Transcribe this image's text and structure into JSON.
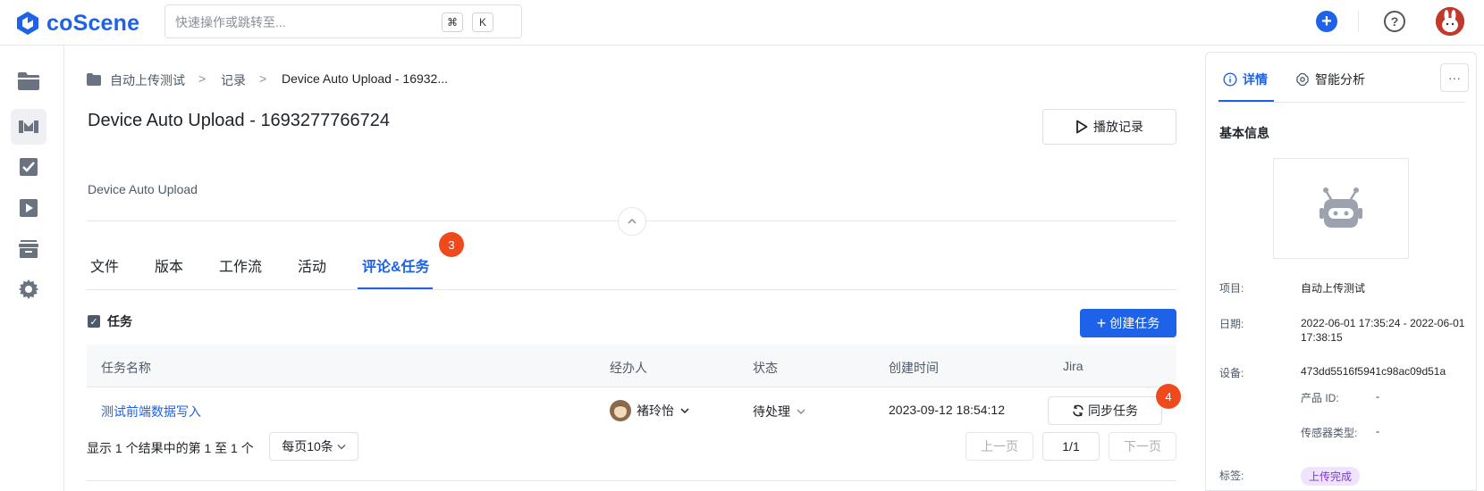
{
  "app": {
    "name": "coScene"
  },
  "search": {
    "placeholder": "快速操作或跳转至...",
    "kbd_cmd": "⌘",
    "kbd_key": "K"
  },
  "topbar": {
    "add_label": "+",
    "help_label": "?"
  },
  "sidebar": {
    "items": [
      {
        "name": "projects",
        "icon": "folder-icon"
      },
      {
        "name": "records",
        "icon": "records-icon",
        "active": true
      },
      {
        "name": "tasks",
        "icon": "task-check-icon"
      },
      {
        "name": "player",
        "icon": "play-icon"
      },
      {
        "name": "archive",
        "icon": "archive-icon"
      },
      {
        "name": "settings",
        "icon": "gear-icon"
      }
    ]
  },
  "breadcrumb": {
    "items": [
      "自动上传测试",
      "记录",
      "Device Auto Upload - 16932..."
    ],
    "separator": ">"
  },
  "record": {
    "title": "Device Auto Upload - 1693277766724",
    "description": "Device Auto Upload",
    "play_label": "播放记录"
  },
  "tabs": [
    {
      "label": "文件"
    },
    {
      "label": "版本"
    },
    {
      "label": "工作流"
    },
    {
      "label": "活动"
    },
    {
      "label": "评论&任务",
      "active": true,
      "badge": "3"
    }
  ],
  "tasks": {
    "section_label": "任务",
    "create_label": "创建任务",
    "columns": [
      "任务名称",
      "经办人",
      "状态",
      "创建时间",
      "Jira"
    ],
    "rows": [
      {
        "name": "测试前端数据写入",
        "assignee": "褚玲怡",
        "status": "待处理",
        "created": "2023-09-12 18:54:12",
        "jira_action": "同步任务",
        "jira_badge": "4"
      }
    ],
    "pagination": {
      "summary": "显示 1 个结果中的第 1 至 1 个",
      "page_size": "每页10条",
      "prev": "上一页",
      "current": "1/1",
      "next": "下一页"
    }
  },
  "details": {
    "tabs": [
      {
        "label": "详情",
        "icon": "info-icon",
        "active": true
      },
      {
        "label": "智能分析",
        "icon": "ai-icon"
      }
    ],
    "more_label": "···",
    "section_title": "基本信息",
    "project_label": "项目:",
    "project_value": "自动上传测试",
    "date_label": "日期:",
    "date_value": "2022-06-01 17:35:24 - 2022-06-01 17:38:15",
    "device_label": "设备:",
    "device_value": "473dd5516f5941c98ac09d51a",
    "product_id_label": "产品 ID:",
    "product_id_value": "-",
    "sensor_label": "传感器类型:",
    "sensor_value": "-",
    "tags_label": "标签:",
    "tag_value": "上传完成"
  },
  "colors": {
    "primary": "#1d62e8",
    "badge": "#f04a1c",
    "tag_bg": "#efe3fd",
    "tag_fg": "#7b3ad6"
  }
}
